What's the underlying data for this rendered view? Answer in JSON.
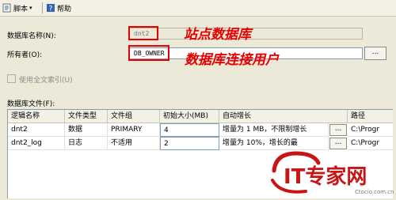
{
  "toolbar": {
    "script_label": "脚本",
    "help_label": "帮助"
  },
  "form": {
    "db_name_label": "数据库名称(N):",
    "db_name_value": "dnt2",
    "owner_label": "所有者(O):",
    "owner_value": "DB_OWNER",
    "browse_label": "...",
    "fulltext_label": "使用全文索引(U)",
    "files_label": "数据库文件(F):"
  },
  "annotations": {
    "site_db": "站点数据库",
    "db_user": "数据库连接用户"
  },
  "table": {
    "columns": [
      "逻辑名称",
      "文件类型",
      "文件组",
      "初始大小(MB)",
      "自动增长",
      "路径"
    ],
    "rows": [
      {
        "name": "dnt2",
        "type": "数据",
        "group": "PRIMARY",
        "size": "4",
        "growth": "增量为 1 MB，不限制增长",
        "btn": "...",
        "path": "C:\\Progr"
      },
      {
        "name": "dnt2_log",
        "type": "日志",
        "group": "不适用",
        "size": "2",
        "growth": "增量为 10%，增长的最",
        "btn": "...",
        "path": "C:\\Progr"
      }
    ]
  },
  "watermark": {
    "brand": "IT专家网",
    "site": "Ctocio.com.cn"
  },
  "colors": {
    "annotation": "#e60000",
    "dialog_bg": "#ece9d8",
    "field_border": "#7f9db9"
  }
}
